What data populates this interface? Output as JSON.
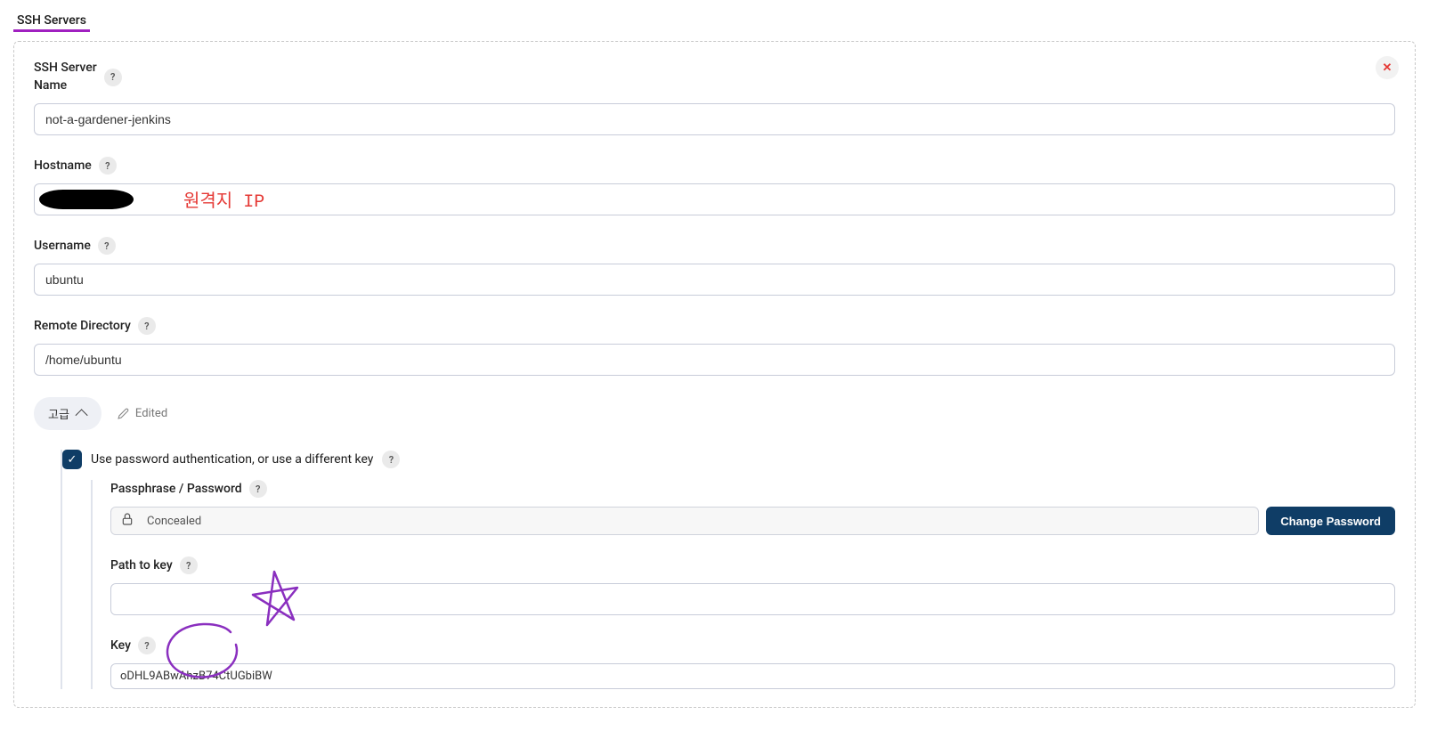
{
  "section_title": "SSH Servers",
  "server": {
    "name_label": "SSH Server\nName",
    "name_value": "not-a-gardener-jenkins",
    "hostname_label": "Hostname",
    "hostname_value": "",
    "hostname_annotation": "원격지 IP",
    "username_label": "Username",
    "username_value": "ubuntu",
    "remote_dir_label": "Remote Directory",
    "remote_dir_value": "/home/ubuntu",
    "advanced_label": "고급",
    "edited_label": "Edited",
    "auth": {
      "checkbox_label": "Use password authentication, or use a different key",
      "checked": true,
      "pass_label": "Passphrase / Password",
      "pass_concealed": "Concealed",
      "change_btn": "Change Password",
      "path_label": "Path to key",
      "path_value": "",
      "key_label": "Key",
      "key_value": "oDHL9ABwAhzB74CtUGbiBW"
    },
    "help_tooltip": "?"
  }
}
